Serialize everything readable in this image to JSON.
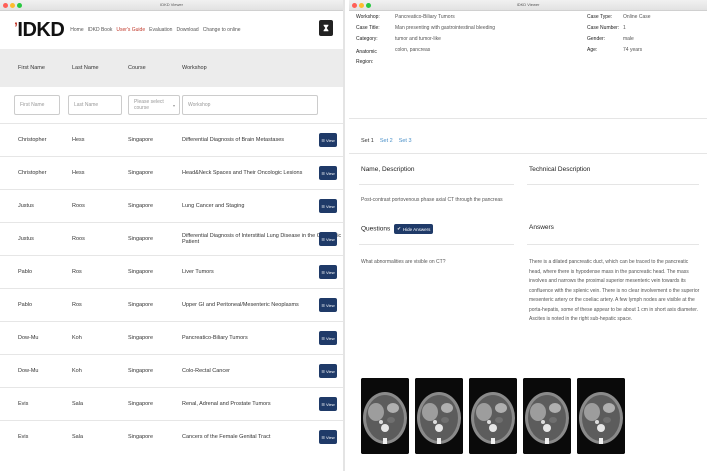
{
  "left_window": {
    "title": "IDKD Viewer",
    "brand": "IDKD",
    "nav": [
      "Home",
      "IDKD Book",
      "User's Guide",
      "Evaluation",
      "Download",
      "Change to online"
    ],
    "active_nav_index": 2,
    "table": {
      "headers": [
        "First Name",
        "Last Name",
        "Course",
        "Workshop"
      ],
      "filters": {
        "first_name": "First Name",
        "last_name": "Last Name",
        "course": "Please select course",
        "workshop": "Workshop"
      },
      "view_label": "View",
      "rows": [
        {
          "first": "Christopher",
          "last": "Hess",
          "course": "Singapore",
          "workshop": "Differential Diagnosis of Brain Metastases"
        },
        {
          "first": "Christopher",
          "last": "Hess",
          "course": "Singapore",
          "workshop": "Head&Neck Spaces and Their Oncologic Lesions"
        },
        {
          "first": "Justus",
          "last": "Roos",
          "course": "Singapore",
          "workshop": "Lung Cancer and Staging"
        },
        {
          "first": "Justus",
          "last": "Roos",
          "course": "Singapore",
          "workshop": "Differential Diagnosis of Interstitial Lung Disease in the Oncologic Patient"
        },
        {
          "first": "Pablo",
          "last": "Ros",
          "course": "Singapore",
          "workshop": "Liver Tumors"
        },
        {
          "first": "Pablo",
          "last": "Ros",
          "course": "Singapore",
          "workshop": "Upper GI and Peritoneal/Mesenteric Neoplasms"
        },
        {
          "first": "Dow-Mu",
          "last": "Koh",
          "course": "Singapore",
          "workshop": "Pancreatico-Biliary Tumors"
        },
        {
          "first": "Dow-Mu",
          "last": "Koh",
          "course": "Singapore",
          "workshop": "Colo-Rectal Cancer"
        },
        {
          "first": "Evis",
          "last": "Sala",
          "course": "Singapore",
          "workshop": "Renal, Adrenal and Prostate Tumors"
        },
        {
          "first": "Evis",
          "last": "Sala",
          "course": "Singapore",
          "workshop": "Cancers of the Female Genital Tract"
        }
      ]
    }
  },
  "right_window": {
    "title": "IDKD Viewer",
    "case": {
      "workshop_label": "Workshop:",
      "workshop": "Pancreatico-Biliary Tumors",
      "title_label": "Case Title:",
      "title": "Man presenting with gastrointestinal bleeding",
      "category_label": "Category:",
      "category": "tumor and tumor-like",
      "region_label": "Anatomic Region:",
      "region": "colon, pancreas",
      "type_label": "Case Type:",
      "type": "Online Case",
      "number_label": "Case Number:",
      "number": "1",
      "gender_label": "Gender:",
      "gender": "male",
      "age_label": "Age:",
      "age": "74 years"
    },
    "tabs": [
      "Set 1",
      "Set 2",
      "Set 3"
    ],
    "active_tab_index": 0,
    "name_description_heading": "Name, Description",
    "technical_description_heading": "Technical Description",
    "description": "Post-contrast portovenous phase axial CT through the pancreas",
    "questions_heading": "Questions",
    "hide_answers_label": "Hide Answers",
    "answers_heading": "Answers",
    "question": "What abnormalities are visible on CT?",
    "answer": "There is a dilated pancreatic duct, which can be traced to the pancreatic head, where there is hypodense mass in the pancreatic head. The mass involves and narrows the proximal superior mesenteric vein towards its confluence with the splenic vein. There is no clear involvement o the superior mesenteric artery or the coeliac artery. A few lymph nodes are visible at the porta-hepatis, some of these appear to be about 1 cm in short axis diameter. Ascites is noted in the right sub-hepatic space.",
    "ct_images_count": 5
  },
  "colors": {
    "accent": "#c0392b",
    "button": "#1f3a68",
    "link": "#4a90c8",
    "header_bg": "#ececec"
  }
}
